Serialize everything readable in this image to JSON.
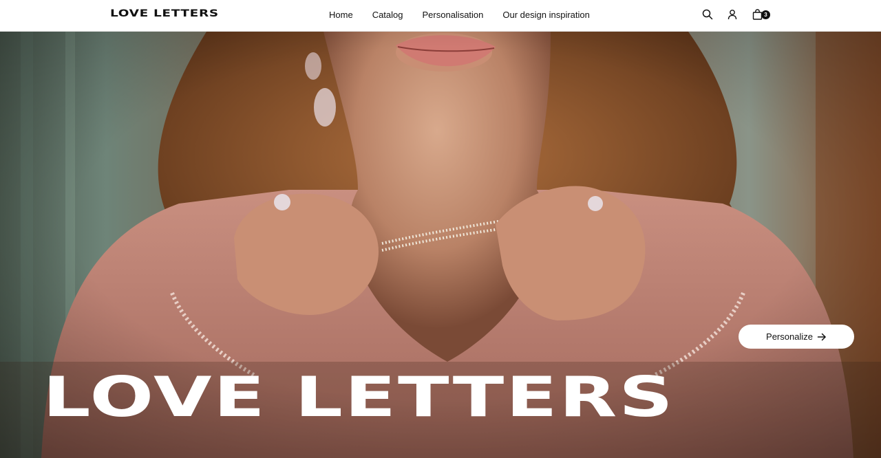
{
  "brand": {
    "logo_text": "LOVE LETTERS"
  },
  "nav": {
    "items": [
      {
        "label": "Home"
      },
      {
        "label": "Catalog"
      },
      {
        "label": "Personalisation"
      },
      {
        "label": "Our design inspiration"
      }
    ]
  },
  "header_icons": {
    "search": "search-icon",
    "account": "user-icon",
    "cart": "shopping-bag-icon",
    "cart_count": "3"
  },
  "hero": {
    "image_alt": "woman holding a pearl necklace",
    "button_label": "Personalize",
    "button_icon": "arrow-right-icon",
    "title": "LOVE LETTERS"
  },
  "colors": {
    "header_bg": "#ffffff",
    "text": "#111111",
    "hero_text": "#ffffff",
    "badge_bg": "#111111"
  }
}
